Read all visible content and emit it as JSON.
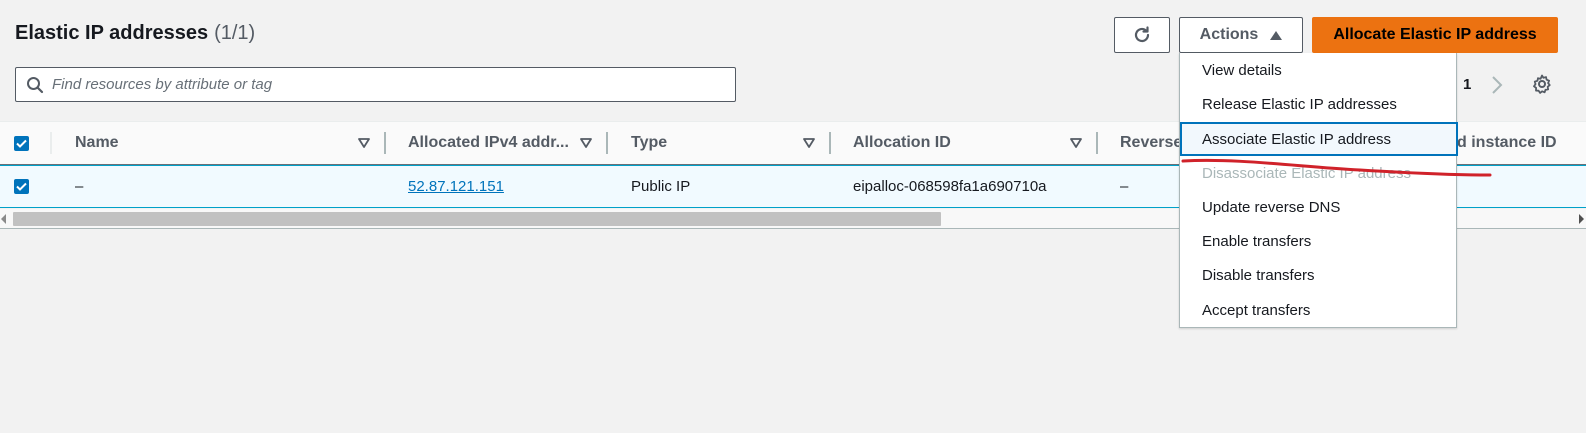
{
  "header": {
    "title": "Elastic IP addresses",
    "count": "(1/1)",
    "actions_label": "Actions",
    "allocate_label": "Allocate Elastic IP address"
  },
  "search": {
    "placeholder": "Find resources by attribute or tag"
  },
  "pagination": {
    "current_page": "1"
  },
  "table": {
    "columns": [
      "Name",
      "Allocated IPv4 addr...",
      "Type",
      "Allocation ID",
      "Reverse",
      "d instance ID"
    ],
    "rows": [
      {
        "name": "–",
        "ipv4": "52.87.121.151",
        "type": "Public IP",
        "allocation_id": "eipalloc-068598fa1a690710a",
        "reverse": "–"
      }
    ]
  },
  "actions_menu": {
    "items": [
      "View details",
      "Release Elastic IP addresses",
      "Associate Elastic IP address",
      "Disassociate Elastic IP address",
      "Update reverse DNS",
      "Enable transfers",
      "Disable transfers",
      "Accept transfers"
    ],
    "highlighted_item": "Associate Elastic IP address",
    "disabled_item": "Disassociate Elastic IP address"
  },
  "colors": {
    "primary_button": "#ec7211",
    "link": "#0073bb",
    "checkbox": "#0073bb",
    "annotation_stroke": "#d0222a"
  },
  "icons": {
    "refresh": "refresh-icon",
    "search": "search-icon",
    "caret": "caret-up-icon",
    "next": "chevron-right-icon",
    "settings": "gear-icon",
    "sort": "sort-down-icon",
    "check": "check-icon"
  }
}
